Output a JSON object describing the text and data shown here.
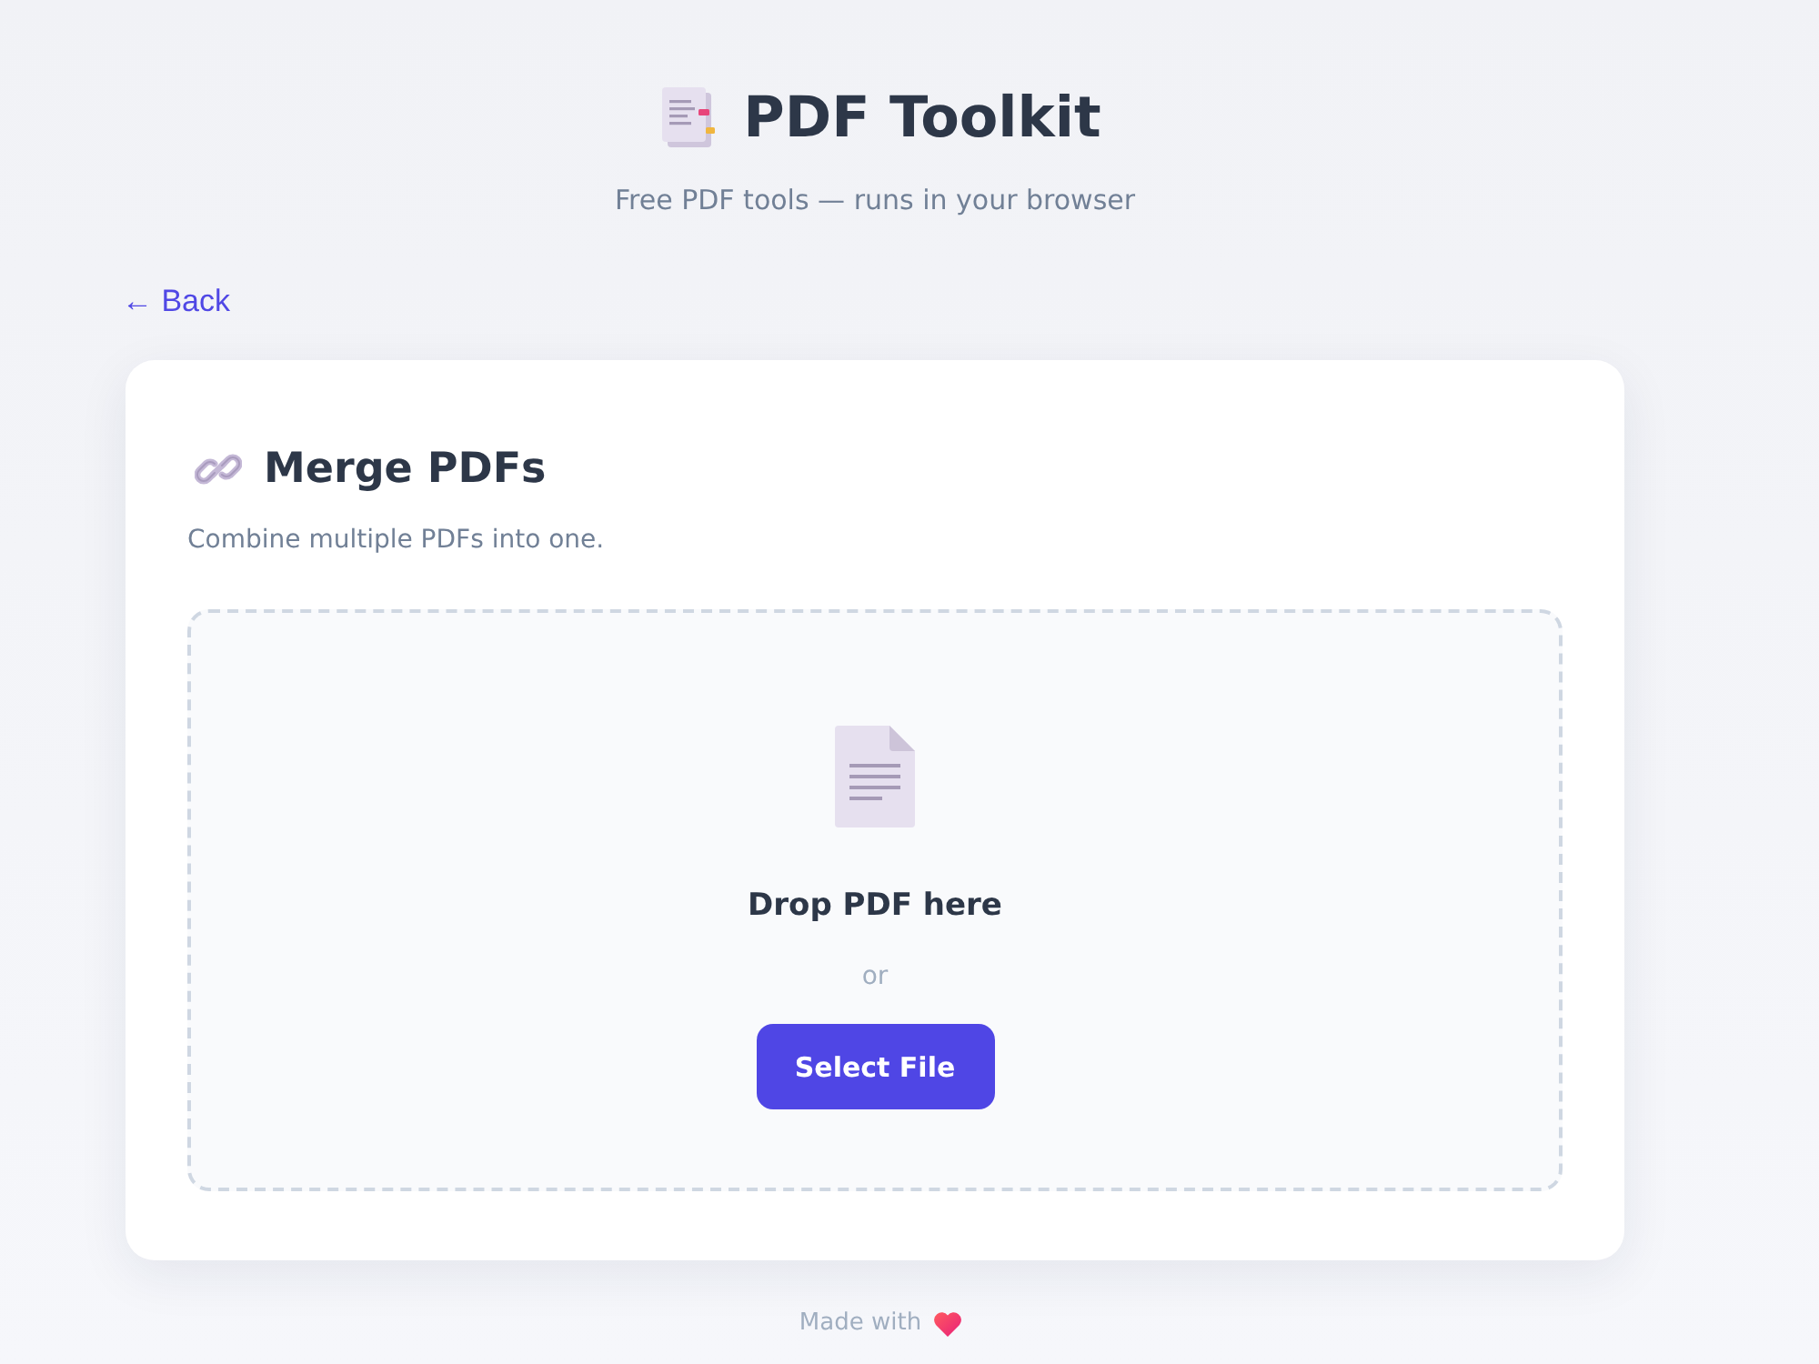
{
  "header": {
    "title": "PDF Toolkit",
    "subtitle": "Free PDF tools — runs in your browser"
  },
  "back_link": {
    "label": "← Back"
  },
  "card": {
    "title": "Merge PDFs",
    "description": "Combine multiple PDFs into one.",
    "drop_zone": {
      "prompt": "Drop PDF here",
      "separator": "or",
      "button": "Select File"
    }
  },
  "footer": {
    "text": "Made with"
  }
}
